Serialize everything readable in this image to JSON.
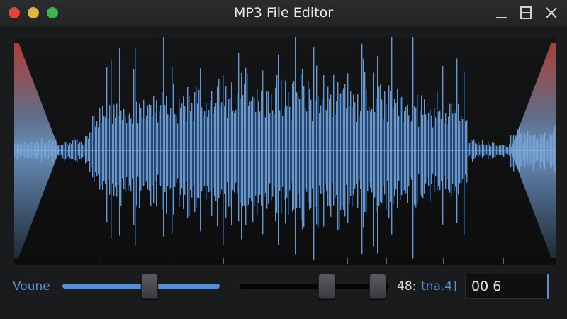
{
  "window": {
    "title": "MP3 File Editor"
  },
  "controls": {
    "volume_label": "Voune",
    "volume_level": 0.55,
    "position_left_level": 0.58,
    "position_right_level": 0.92,
    "readout_number": "48:",
    "readout_unit": "tna.4]",
    "value_field": "00 6"
  },
  "colors": {
    "accent": "#5b8fd0",
    "waveform": "#7aa4d6",
    "fade_red": "#c9463d",
    "close": "#e0443e",
    "minimize": "#dcb43a",
    "maximize": "#3fb34f"
  },
  "icons": {
    "minimize": "minimize-icon",
    "maximize": "maximize-icon",
    "close": "close-icon"
  }
}
